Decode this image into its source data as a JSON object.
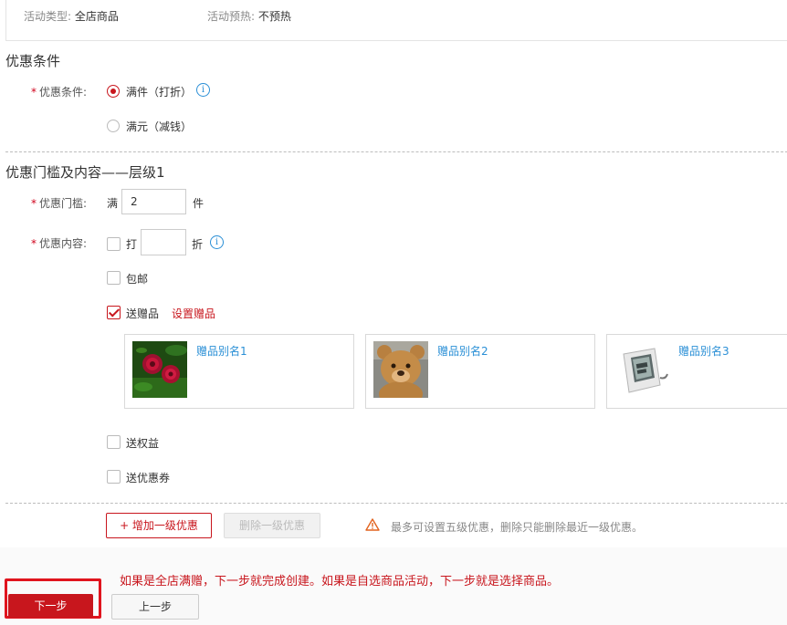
{
  "activity_info": {
    "type_key": "活动类型:",
    "type_value": "全店商品",
    "preheat_key": "活动预热:",
    "preheat_value": "不预热"
  },
  "condition_section": {
    "title": "优惠条件",
    "label": "优惠条件:",
    "options": [
      {
        "label": "满件（打折）",
        "selected": true
      },
      {
        "label": "满元（减钱）",
        "selected": false
      }
    ]
  },
  "tier_section": {
    "title": "优惠门槛及内容——层级1",
    "threshold": {
      "label": "优惠门槛:",
      "prefix": "满",
      "value": "2",
      "suffix": "件"
    },
    "content": {
      "label": "优惠内容:",
      "discount": {
        "prefix": "打",
        "value": "",
        "suffix": "折",
        "checked": false
      },
      "free_shipping": {
        "label": "包邮",
        "checked": false
      },
      "gift": {
        "label": "送赠品",
        "checked": true,
        "set_link": "设置赠品"
      },
      "gifts": [
        {
          "name": "赠品别名1",
          "image": "red-flower-photo"
        },
        {
          "name": "赠品别名2",
          "image": "teddy-bear-photo"
        },
        {
          "name": "赠品别名3",
          "image": "digital-hygrometer-photo"
        }
      ],
      "benefit": {
        "label": "送权益",
        "checked": false
      },
      "coupon": {
        "label": "送优惠券",
        "checked": false
      }
    }
  },
  "tier_actions": {
    "add_label": "+ 增加一级优惠",
    "delete_label": "删除一级优惠",
    "hint": "最多可设置五级优惠，删除只能删除最近一级优惠。"
  },
  "footer": {
    "note": "如果是全店满赠，下一步就完成创建。如果是自选商品活动，下一步就是选择商品。",
    "next_label": "下一步",
    "prev_label": "上一步"
  },
  "colors": {
    "accent_red": "#c8161d",
    "link_blue": "#2a8fd6"
  }
}
